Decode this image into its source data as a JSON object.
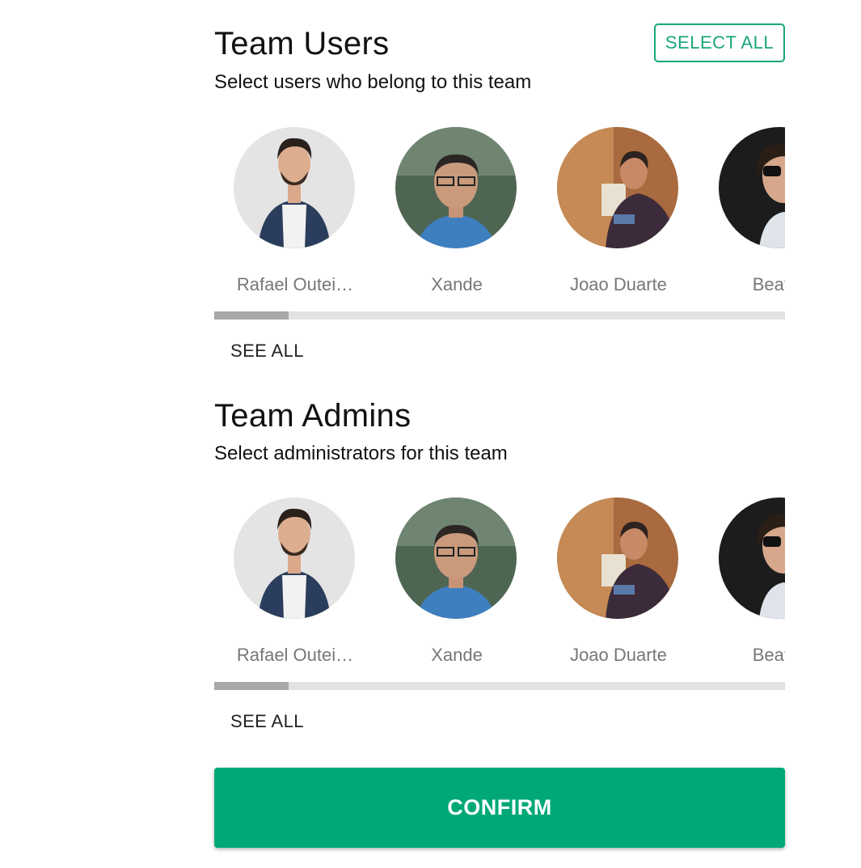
{
  "team_users": {
    "title": "Team Users",
    "subtitle": "Select users who belong to this team",
    "select_all_label": "SELECT ALL",
    "see_all_label": "SEE ALL",
    "scroll_position": 0.13,
    "users": [
      {
        "name": "Rafael Outei…"
      },
      {
        "name": "Xande"
      },
      {
        "name": "Joao Duarte"
      },
      {
        "name": "Beatriz"
      }
    ]
  },
  "team_admins": {
    "title": "Team Admins",
    "subtitle": "Select administrators for this team",
    "see_all_label": "SEE ALL",
    "scroll_position": 0.13,
    "users": [
      {
        "name": "Rafael Outei…"
      },
      {
        "name": "Xande"
      },
      {
        "name": "Joao Duarte"
      },
      {
        "name": "Beatriz"
      }
    ]
  },
  "confirm_label": "CONFIRM",
  "colors": {
    "accent": "#00a878",
    "accent_border": "#1aa57c",
    "name_text": "#777777",
    "scroll_track": "#e2e2e2",
    "scroll_thumb": "#a9a9a9"
  }
}
